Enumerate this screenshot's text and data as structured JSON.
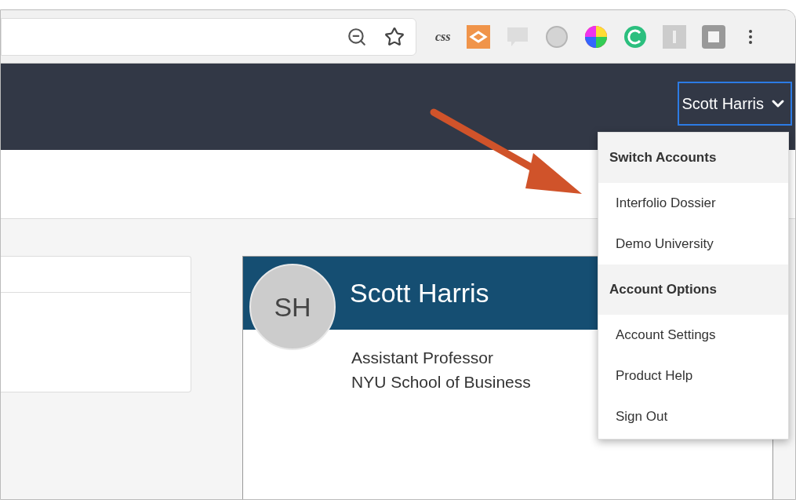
{
  "browser_toolbar": {
    "extension_label": "css"
  },
  "nav": {
    "user_menu": {
      "label": "Scott Harris",
      "expanded": true
    }
  },
  "dropdown": {
    "sections": [
      {
        "header": "Switch Accounts",
        "items": [
          "Interfolio Dossier",
          "Demo University"
        ]
      },
      {
        "header": "Account Options",
        "items": [
          "Account Settings",
          "Product Help",
          "Sign Out"
        ]
      }
    ]
  },
  "profile_card": {
    "initials": "SH",
    "name": "Scott Harris",
    "title": "Assistant Professor",
    "institution": "NYU School of Business"
  }
}
